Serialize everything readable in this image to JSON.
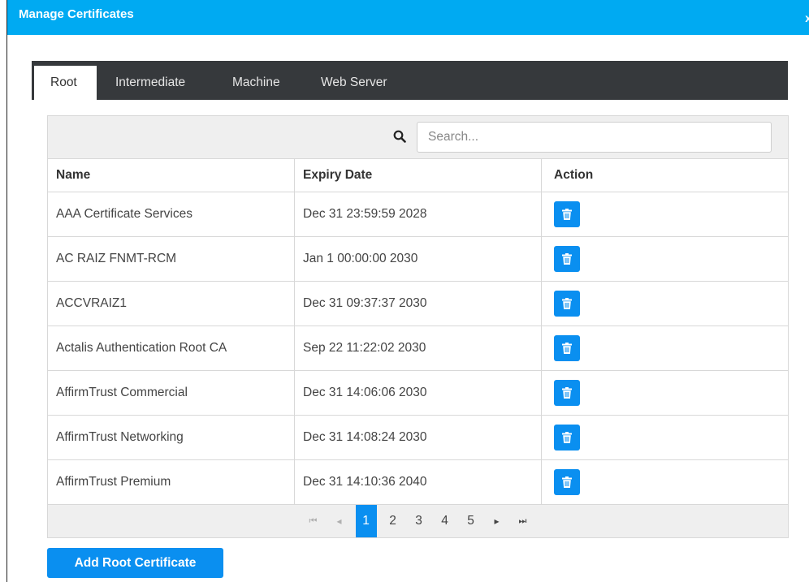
{
  "dialog": {
    "title": "Manage Certificates",
    "close_glyph": "x"
  },
  "tabs": [
    {
      "label": "Root"
    },
    {
      "label": "Intermediate"
    },
    {
      "label": "Machine"
    },
    {
      "label": "Web Server"
    }
  ],
  "search": {
    "placeholder": "Search...",
    "value": ""
  },
  "table": {
    "headers": [
      "Name",
      "Expiry Date",
      "Action"
    ],
    "rows": [
      {
        "name": "AAA Certificate Services",
        "expiry": "Dec 31 23:59:59 2028"
      },
      {
        "name": "AC RAIZ FNMT-RCM",
        "expiry": "Jan 1 00:00:00 2030"
      },
      {
        "name": "ACCVRAIZ1",
        "expiry": "Dec 31 09:37:37 2030"
      },
      {
        "name": "Actalis Authentication Root CA",
        "expiry": "Sep 22 11:22:02 2030"
      },
      {
        "name": "AffirmTrust Commercial",
        "expiry": "Dec 31 14:06:06 2030"
      },
      {
        "name": "AffirmTrust Networking",
        "expiry": "Dec 31 14:08:24 2030"
      },
      {
        "name": "AffirmTrust Premium",
        "expiry": "Dec 31 14:10:36 2040"
      }
    ]
  },
  "pagination": {
    "first": "⏮",
    "prev": "◂",
    "pages": [
      "1",
      "2",
      "3",
      "4",
      "5"
    ],
    "current": "1",
    "next": "▸",
    "last": "⏭"
  },
  "add_button": {
    "label": "Add Root Certificate"
  },
  "colors": {
    "accent": "#00aaf2",
    "button": "#0a8ff0",
    "tabbar": "#36393c"
  },
  "icons": {
    "delete": "trash-icon",
    "search": "search-icon",
    "close": "close-icon"
  }
}
